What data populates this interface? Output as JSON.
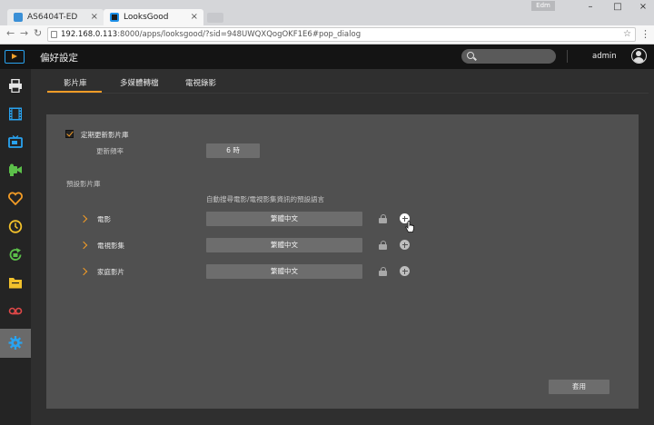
{
  "browser": {
    "tabs": [
      {
        "title": "AS6404T-ED",
        "active": false
      },
      {
        "title": "LooksGood",
        "active": true
      }
    ],
    "user_badge": "Edm",
    "url": "192.168.0.113:8000/apps/looksgood/?sid=948UWQXQogOKF1E6#pop_dialog",
    "url_host": "192.168.0.113",
    "url_rest": ":8000/apps/looksgood/?sid=948UWQXQogOKF1E6#pop_dialog"
  },
  "app": {
    "title": "偏好設定",
    "username": "admin"
  },
  "sidebar": {
    "items": [
      {
        "icon": "printer-icon",
        "color": "#e6e6e6"
      },
      {
        "icon": "film-icon",
        "color": "#29a3f0"
      },
      {
        "icon": "tv-icon",
        "color": "#29a3f0"
      },
      {
        "icon": "camcorder-icon",
        "color": "#5cc04a"
      },
      {
        "icon": "heart-icon",
        "color": "#f39c26"
      },
      {
        "icon": "clock-icon",
        "color": "#f2c12b"
      },
      {
        "icon": "refresh-icon",
        "color": "#5cc04a"
      },
      {
        "icon": "folder-icon",
        "color": "#f2c12b"
      },
      {
        "icon": "recorder-icon",
        "color": "#e04848"
      },
      {
        "icon": "gear-icon",
        "color": "#29a3f0",
        "active": true
      }
    ]
  },
  "tabs": [
    "影片庫",
    "多媒體轉檔",
    "電視錄影"
  ],
  "settings": {
    "auto_update_label": "定期更新影片庫",
    "auto_update_checked": true,
    "frequency_label": "更新頻率",
    "frequency_value": "6 時",
    "library_section_label": "預設影片庫",
    "language_column_label": "自動搜尋電影/電視影集資訊的預設語言",
    "libraries": [
      {
        "name": "電影",
        "language": "繁體中文"
      },
      {
        "name": "電視影集",
        "language": "繁體中文"
      },
      {
        "name": "家庭影片",
        "language": "繁體中文"
      }
    ],
    "apply_label": "套用"
  },
  "colors": {
    "accent": "#f39c26",
    "header_bg": "#141414",
    "sidebar_bg": "#242424",
    "panel_bg": "#505050",
    "button_bg": "#6d6d6d"
  }
}
